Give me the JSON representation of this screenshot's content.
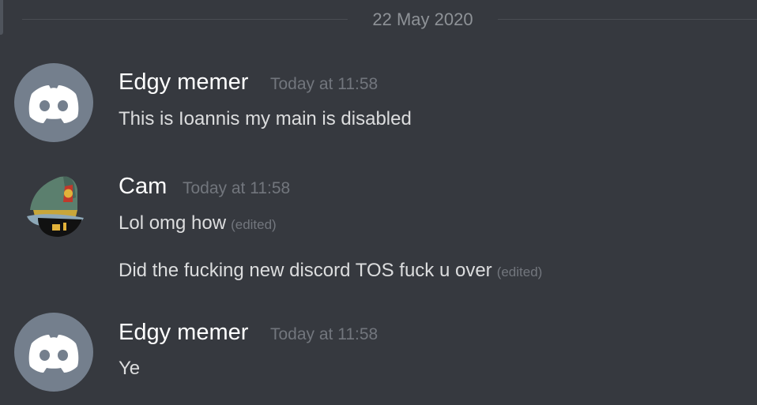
{
  "chat": {
    "date_divider": "22 May 2020",
    "messages": [
      {
        "author": "Edgy memer",
        "timestamp": "Today at 11:58",
        "avatar_icon": "discord-default-avatar-icon",
        "lines": [
          {
            "text": "This is Ioannis my main is disabled",
            "edited": ""
          }
        ]
      },
      {
        "author": "Cam",
        "timestamp": "Today at 11:58",
        "avatar_icon": "military-officer-cap-avatar-icon",
        "lines": [
          {
            "text": "Lol omg how",
            "edited": "(edited)"
          },
          {
            "text": "Did the fucking new discord TOS fuck u over",
            "edited": "(edited)"
          }
        ]
      },
      {
        "author": "Edgy memer",
        "timestamp": "Today at 11:58",
        "avatar_icon": "discord-default-avatar-icon",
        "lines": [
          {
            "text": "Ye",
            "edited": ""
          }
        ]
      }
    ]
  },
  "colors": {
    "background": "#36393f",
    "username": "#ffffff",
    "message_text": "#dcddde",
    "muted": "#72767d",
    "default_avatar": "#747f8d"
  }
}
